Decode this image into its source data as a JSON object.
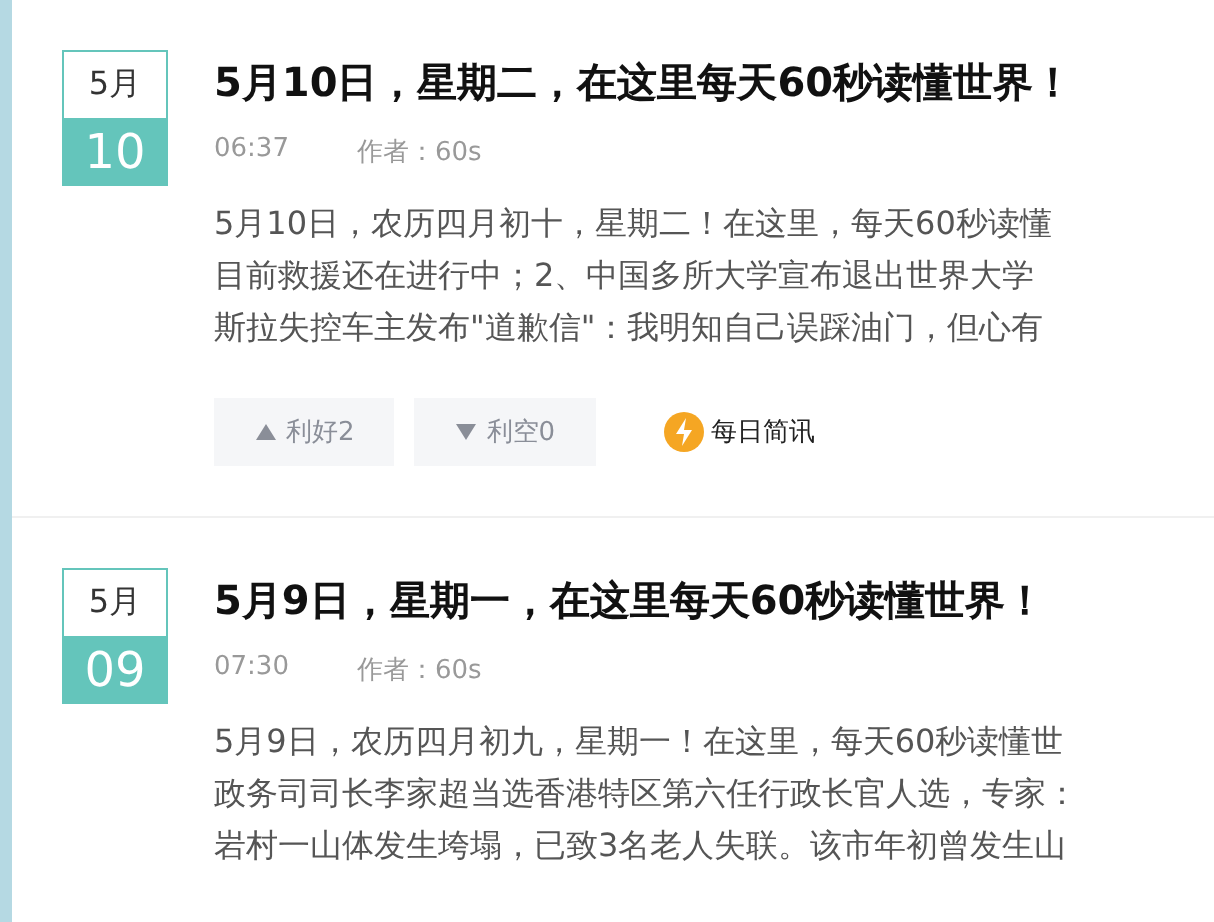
{
  "articles": [
    {
      "month": "5月",
      "day": "10",
      "title": "5月10日，星期二，在这里每天60秒读懂世界！",
      "time": "06:37",
      "author": "作者：60s",
      "excerpt_lines": [
        "5月10日，农历四月初十，星期二！在这里，每天60秒读懂",
        "目前救援还在进行中；2、中国多所大学宣布退出世界大学",
        "斯拉失控车主发布\"道歉信\"：我明知自己误踩油门，但心有"
      ],
      "actions": [
        {
          "kind": "up",
          "label": "利好2"
        },
        {
          "kind": "down",
          "label": "利空0"
        }
      ],
      "tag": "每日简讯"
    },
    {
      "month": "5月",
      "day": "09",
      "title": "5月9日，星期一，在这里每天60秒读懂世界！",
      "time": "07:30",
      "author": "作者：60s",
      "excerpt_lines": [
        "5月9日，农历四月初九，星期一！在这里，每天60秒读懂世",
        "政务司司长李家超当选香港特区第六任行政长官人选，专家：",
        "岩村一山体发生垮塌，已致3名老人失联。该市年初曾发生山"
      ]
    }
  ]
}
